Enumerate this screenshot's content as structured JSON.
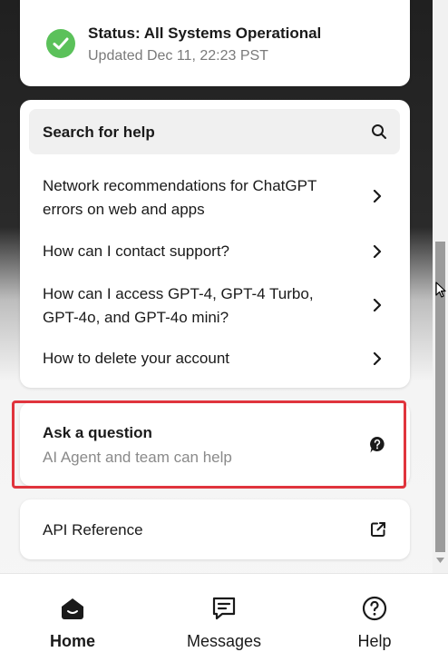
{
  "status": {
    "title": "Status: All Systems Operational",
    "updated": "Updated Dec 11, 22:23 PST"
  },
  "search": {
    "label": "Search for help"
  },
  "help_items": [
    {
      "label": "Network recommendations for ChatGPT errors on web and apps"
    },
    {
      "label": "How can I contact support?"
    },
    {
      "label": "How can I access GPT-4, GPT-4 Turbo, GPT-4o, and GPT-4o mini?"
    },
    {
      "label": "How to delete your account"
    }
  ],
  "ask": {
    "title": "Ask a question",
    "subtitle": "AI Agent and team can help"
  },
  "api": {
    "label": "API Reference"
  },
  "nav": [
    {
      "label": "Home",
      "icon": "home-icon",
      "active": true
    },
    {
      "label": "Messages",
      "icon": "messages-icon",
      "active": false
    },
    {
      "label": "Help",
      "icon": "help-icon",
      "active": false
    }
  ],
  "colors": {
    "status_green": "#5bc15a",
    "highlight_red": "#e0343d"
  }
}
